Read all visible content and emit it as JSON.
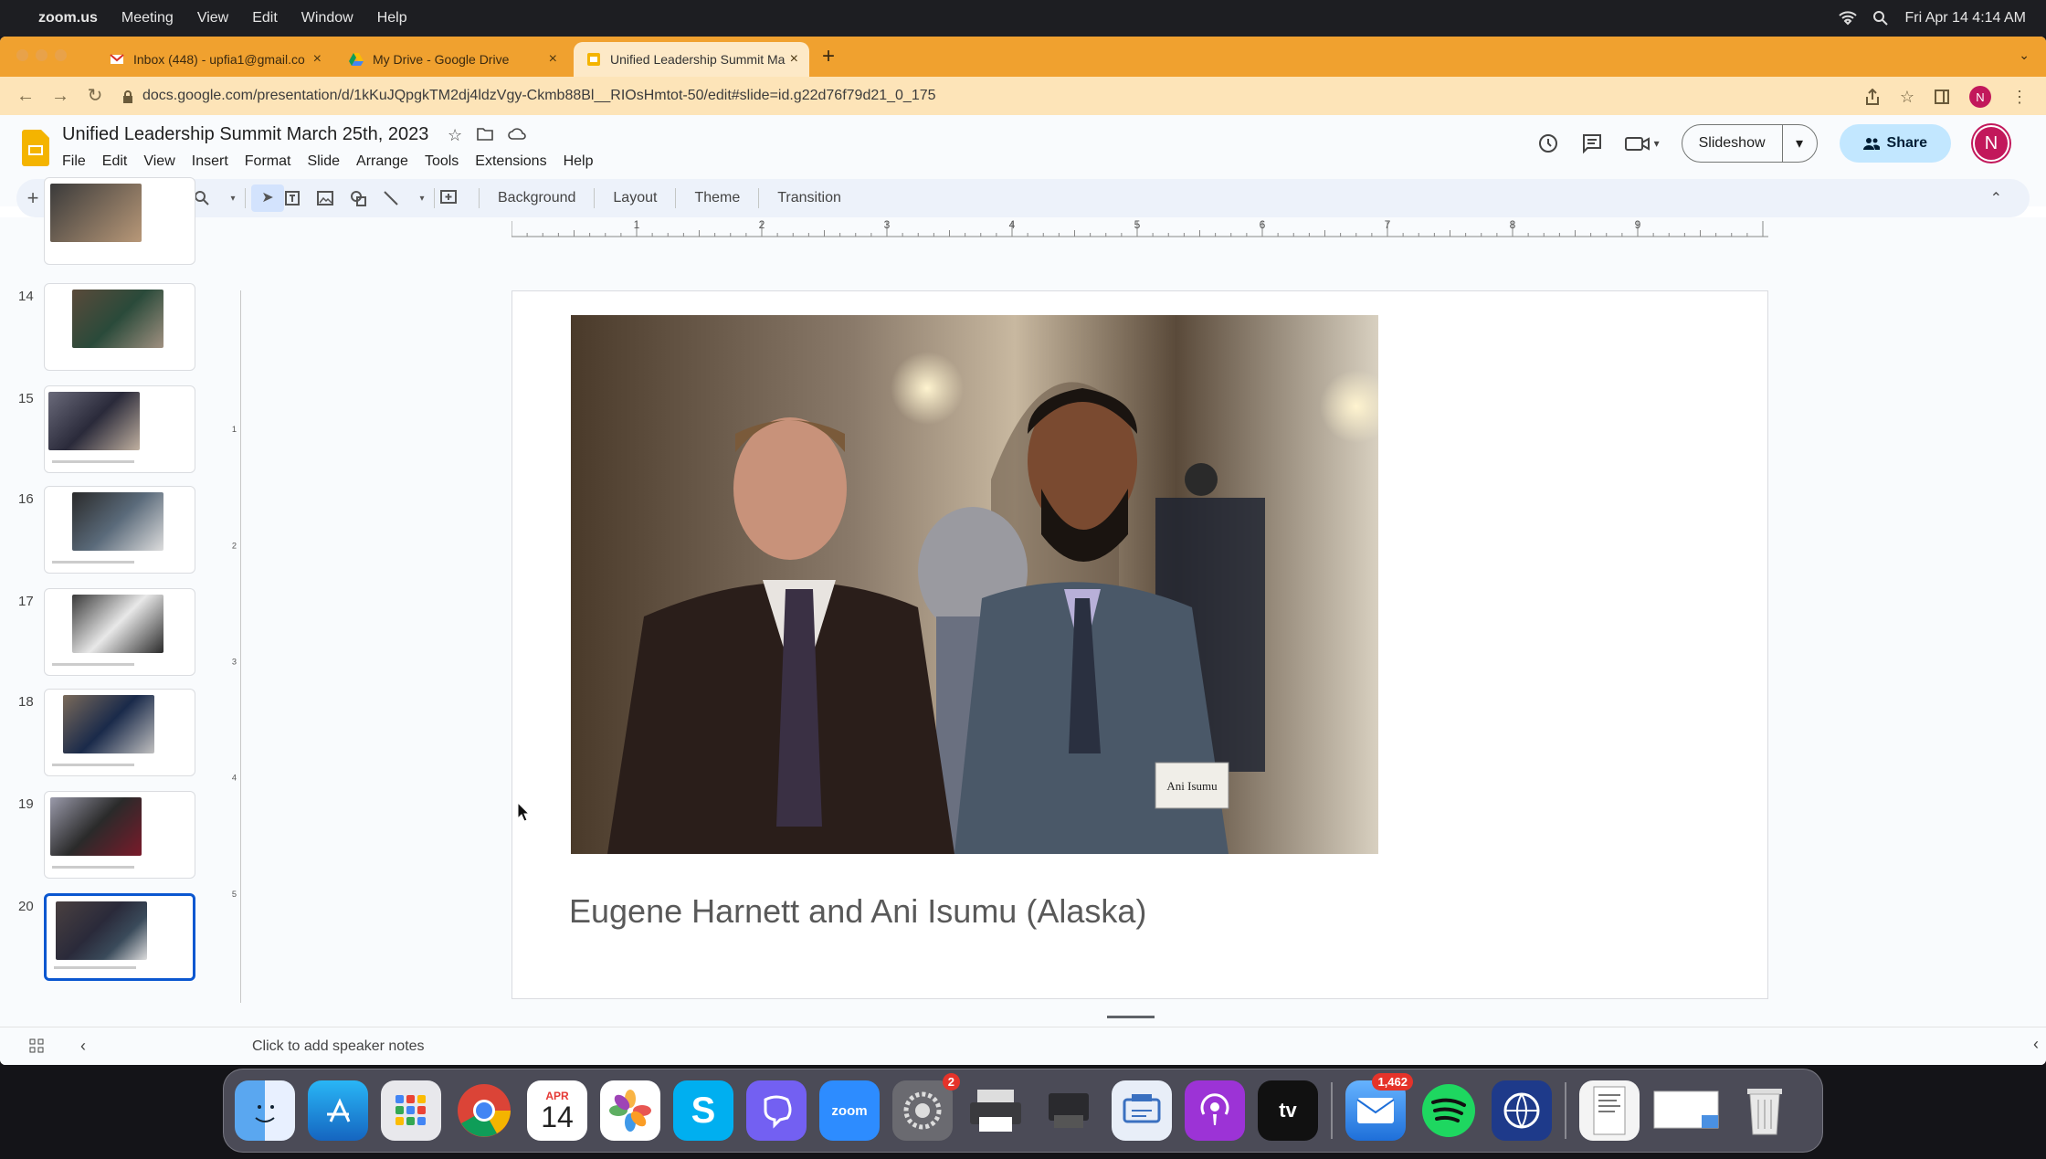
{
  "menubar": {
    "app": "zoom.us",
    "items": [
      "Meeting",
      "View",
      "Edit",
      "Window",
      "Help"
    ],
    "clock": "Fri Apr 14  4:14 AM"
  },
  "tabs": [
    {
      "label": "Inbox (448) - upfia1@gmail.co",
      "icon": "gmail-icon"
    },
    {
      "label": "My Drive - Google Drive",
      "icon": "drive-icon"
    },
    {
      "label": "Unified Leadership Summit Ma",
      "icon": "slides-icon"
    }
  ],
  "address": {
    "url": "docs.google.com/presentation/d/1kKuJQpgkTM2dj4ldzVgy-Ckmb88Bl__RIOsHmtot-50/edit#slide=id.g22d76f79d21_0_175"
  },
  "doc": {
    "title": "Unified Leadership Summit  March 25th, 2023",
    "menus": [
      "File",
      "Edit",
      "View",
      "Insert",
      "Format",
      "Slide",
      "Arrange",
      "Tools",
      "Extensions",
      "Help"
    ]
  },
  "header_buttons": {
    "slideshow": "Slideshow",
    "share": "Share",
    "avatar": "N"
  },
  "toolbar": {
    "background": "Background",
    "layout": "Layout",
    "theme": "Theme",
    "transition": "Transition"
  },
  "ruler": {
    "marks": [
      "1",
      "2",
      "3",
      "4",
      "5",
      "6",
      "7",
      "8",
      "9"
    ],
    "left_marks": [
      "1",
      "2",
      "3",
      "4",
      "5"
    ]
  },
  "filmstrip": {
    "slides": [
      {
        "number": "",
        "selected": false
      },
      {
        "number": "14",
        "selected": false
      },
      {
        "number": "15",
        "selected": false
      },
      {
        "number": "16",
        "selected": false
      },
      {
        "number": "17",
        "selected": false
      },
      {
        "number": "18",
        "selected": false
      },
      {
        "number": "19",
        "selected": false
      },
      {
        "number": "20",
        "selected": true
      }
    ]
  },
  "slide": {
    "caption": "Eugene Harnett and Ani Isumu (Alaska)",
    "name_tag": "Ani Isumu"
  },
  "notes": {
    "placeholder": "Click to add speaker notes"
  },
  "dock": {
    "calendar_month": "APR",
    "calendar_day": "14",
    "zoom_label": "zoom",
    "tv_label": "tv",
    "badges": {
      "settings": "2",
      "mail": "1,462"
    }
  },
  "colors": {
    "tab_strip": "#f0a12f",
    "address_bar": "#fde4b8",
    "share_button": "#c2e7ff",
    "selected_thumb": "#0b57d0"
  }
}
